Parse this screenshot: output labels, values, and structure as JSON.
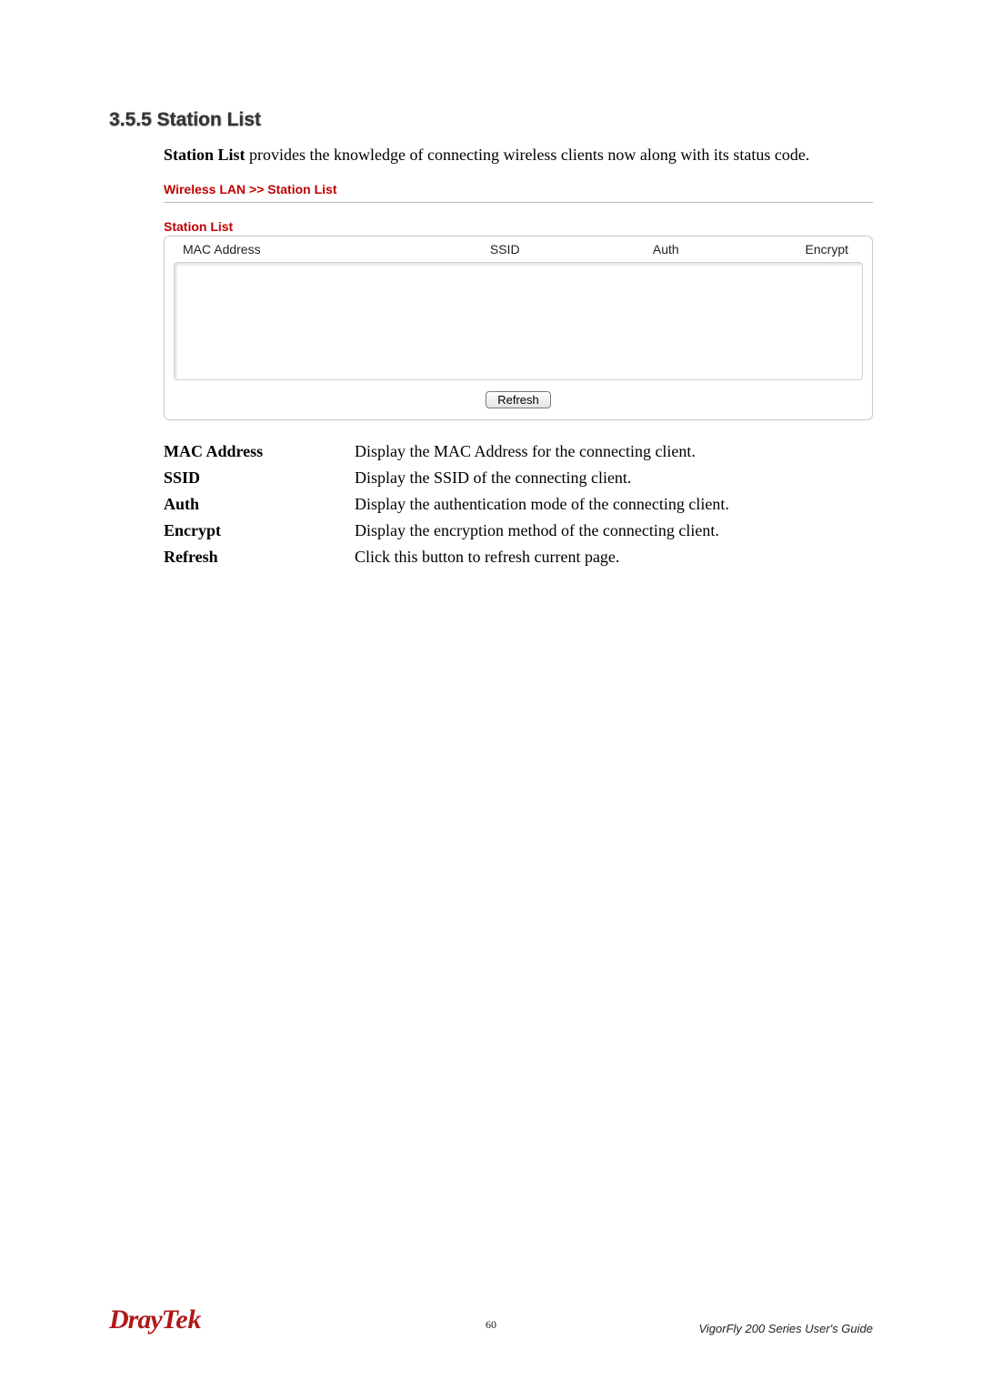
{
  "heading": "3.5.5 Station List",
  "intro_bold": "Station List",
  "intro_rest": " provides the knowledge of connecting wireless clients now along with its status code.",
  "breadcrumb": "Wireless LAN >> Station List",
  "subheading": "Station List",
  "columns": {
    "mac": "MAC Address",
    "ssid": "SSID",
    "auth": "Auth",
    "encrypt": "Encrypt"
  },
  "refresh_label": "Refresh",
  "definitions": [
    {
      "term": "MAC Address",
      "desc": "Display the MAC Address for the connecting client."
    },
    {
      "term": "SSID",
      "desc": "Display the SSID of the connecting client."
    },
    {
      "term": "Auth",
      "desc": "Display the authentication mode of the connecting client."
    },
    {
      "term": "Encrypt",
      "desc": "Display the encryption method of the connecting client."
    },
    {
      "term": "Refresh",
      "desc": "Click this button to refresh current page."
    }
  ],
  "footer": {
    "logo_left": "Dray",
    "logo_right": "Tek",
    "page_number": "60",
    "guide": "VigorFly 200 Series User's Guide"
  }
}
